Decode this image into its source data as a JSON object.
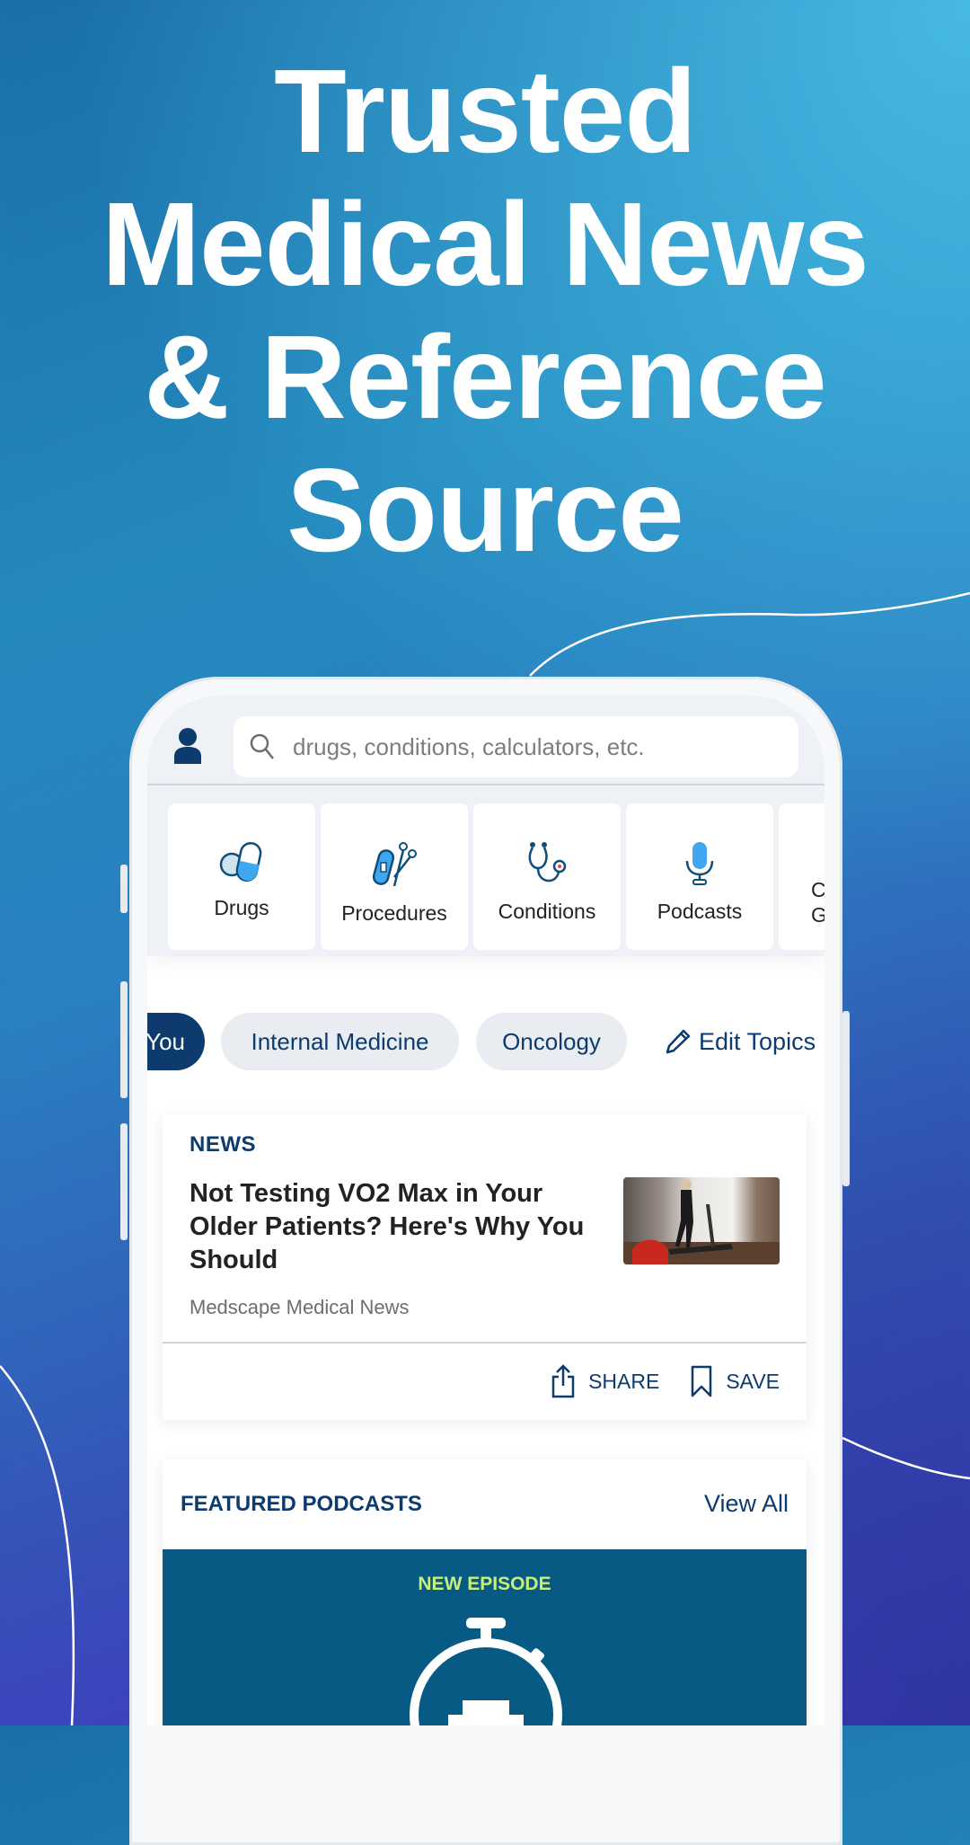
{
  "headline": [
    "Trusted",
    "Medical News",
    "& Reference",
    "Source"
  ],
  "search": {
    "placeholder": "drugs, conditions, calculators, etc."
  },
  "tiles": [
    {
      "label": "Drugs",
      "icon": "pill-capsule-icon"
    },
    {
      "label": "Procedures",
      "icon": "bandage-scissors-icon"
    },
    {
      "label": "Conditions",
      "icon": "stethoscope-icon"
    },
    {
      "label": "Podcasts",
      "icon": "microphone-icon"
    },
    {
      "label": "C G",
      "icon": ""
    }
  ],
  "chips": {
    "active": "You",
    "items": [
      "Internal Medicine",
      "Oncology"
    ],
    "edit": "Edit Topics"
  },
  "news": {
    "kicker": "NEWS",
    "title": "Not Testing VO2 Max in Your Older Patients? Here's Why You Should",
    "source": "Medscape Medical News",
    "share": "SHARE",
    "save": "SAVE"
  },
  "podcasts": {
    "header": "FEATURED PODCASTS",
    "view_all": "View All",
    "badge": "NEW EPISODE"
  },
  "colors": {
    "brand": "#0d3b6e",
    "accent": "#3fa7f0",
    "episode": "#c7ef7a",
    "podcast_bg": "#075a84"
  }
}
